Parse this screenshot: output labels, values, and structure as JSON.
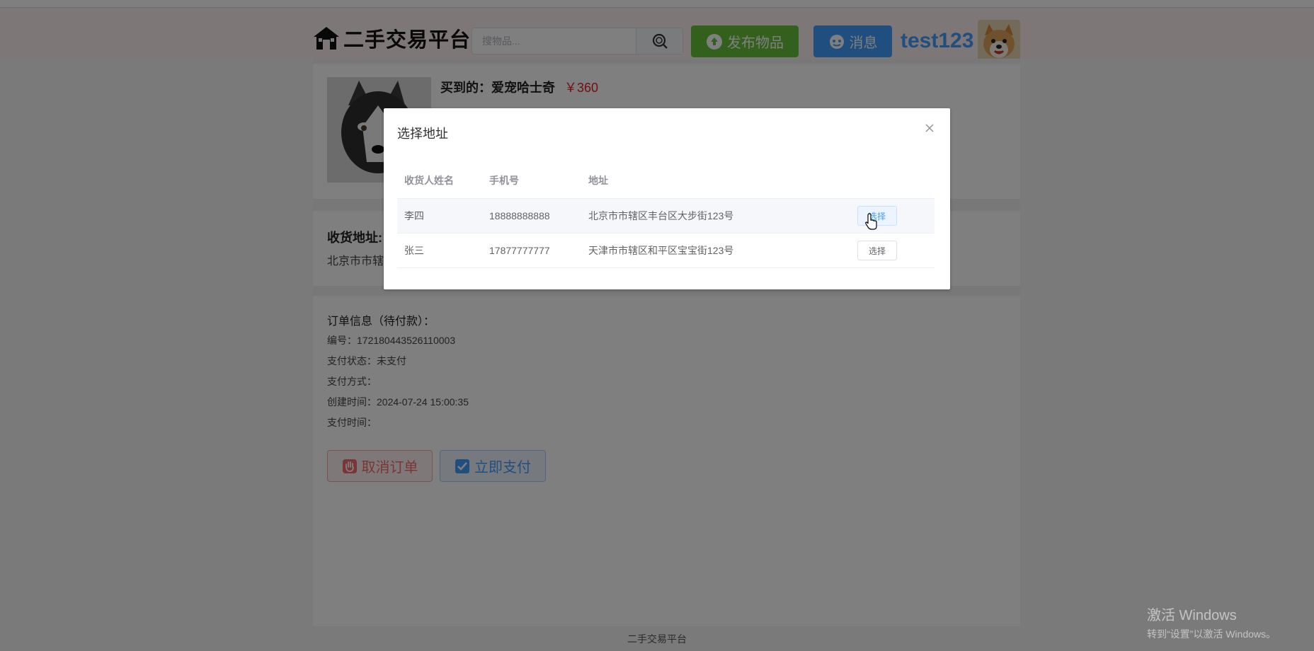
{
  "header": {
    "logo_text": "二手交易平台",
    "search_placeholder": "搜物品...",
    "publish_label": "发布物品",
    "message_label": "消息",
    "username": "test123"
  },
  "product": {
    "title": "买到的：爱宠哈士奇",
    "price": "￥360"
  },
  "address_card": {
    "label": "收货地址:",
    "value": "北京市市辖"
  },
  "order": {
    "title": "订单信息（待付款）：",
    "number": "编号：172180443526110003",
    "pay_status": "支付状态：未支付",
    "pay_method": "支付方式：",
    "created": "创建时间：2024-07-24 15:00:35",
    "paid_time": "支付时间：",
    "cancel_label": "取消订单",
    "pay_label": "立即支付"
  },
  "footer": "二手交易平台",
  "dialog": {
    "title": "选择地址",
    "columns": [
      "收货人姓名",
      "手机号",
      "地址"
    ],
    "rows": [
      {
        "name": "李四",
        "phone": "18888888888",
        "address": "北京市市辖区丰台区大步街123号",
        "action": "选择"
      },
      {
        "name": "张三",
        "phone": "17877777777",
        "address": "天津市市辖区和平区宝宝街123号",
        "action": "选择"
      }
    ]
  },
  "watermark": {
    "line1": "激活 Windows",
    "line2": "转到“设置”以激活 Windows。"
  },
  "colors": {
    "primary": "#409eff",
    "success": "#67c23a",
    "danger": "#f56c6c",
    "header_bg": "#fdeeee",
    "price": "#e02020"
  },
  "icons": {
    "logo": "house-icon",
    "search": "search-icon",
    "publish": "publish-icon",
    "message": "message-icon",
    "cancel": "hand-icon",
    "pay": "check-square-icon",
    "close": "close-icon"
  }
}
